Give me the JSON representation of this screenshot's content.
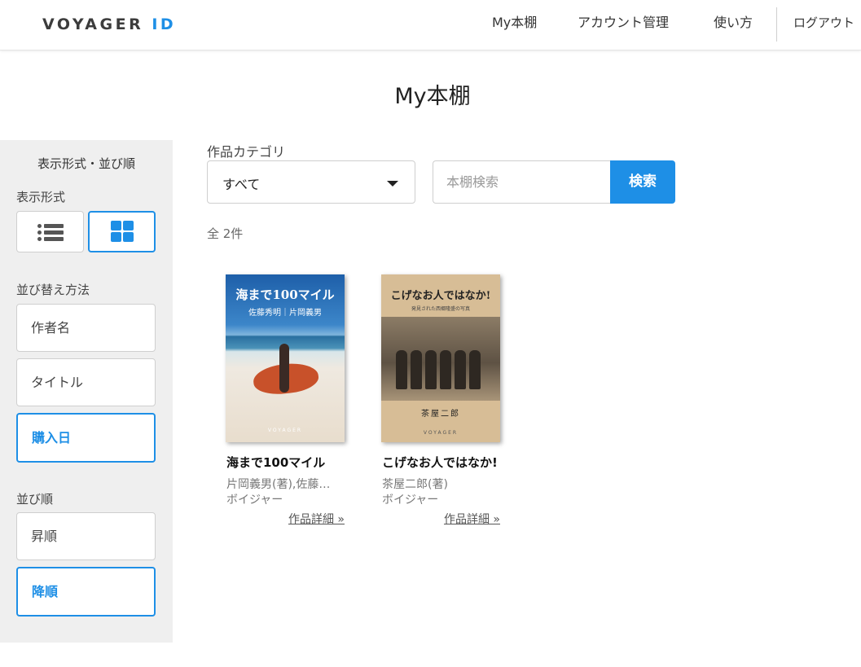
{
  "header": {
    "logo_main": "VOYAGER",
    "logo_id": "ID",
    "nav": [
      "My本棚",
      "アカウント管理",
      "使い方",
      "ログアウト"
    ]
  },
  "page": {
    "title": "My本棚"
  },
  "sidebar": {
    "heading": "表示形式・並び順",
    "view_label": "表示形式",
    "view_modes": {
      "list": "list-icon",
      "grid": "grid-icon",
      "selected": "grid"
    },
    "sort_label": "並び替え方法",
    "sort_options": [
      "作者名",
      "タイトル",
      "購入日"
    ],
    "sort_selected": "購入日",
    "order_label": "並び順",
    "order_options": [
      "昇順",
      "降順"
    ],
    "order_selected": "降順"
  },
  "filter": {
    "category_label": "作品カテゴリ",
    "category_value": "すべて",
    "search_placeholder": "本棚検索",
    "search_value": "",
    "search_button": "検索"
  },
  "results": {
    "count_label": "全 2件",
    "books": [
      {
        "title": "海まで100マイル",
        "author": "片岡義男(著),佐藤秀明(写真)",
        "publisher": "ボイジャー",
        "link": "作品詳細 »",
        "cover_title": "海まで100マイル",
        "cover_sub": "佐藤秀明｜片岡義男",
        "cover_brand": "VOYAGER"
      },
      {
        "title": "こげなお人ではなか!",
        "author": "茶屋二郎(著)",
        "publisher": "ボイジャー",
        "link": "作品詳細 »",
        "cover_title": "こげなお人ではなか!",
        "cover_sub": "発見された西郷隆盛の写真",
        "cover_author": "茶屋二郎",
        "cover_brand": "VOYAGER"
      }
    ]
  },
  "colors": {
    "accent": "#1e8fe6",
    "sidebar_bg": "#efefef"
  }
}
